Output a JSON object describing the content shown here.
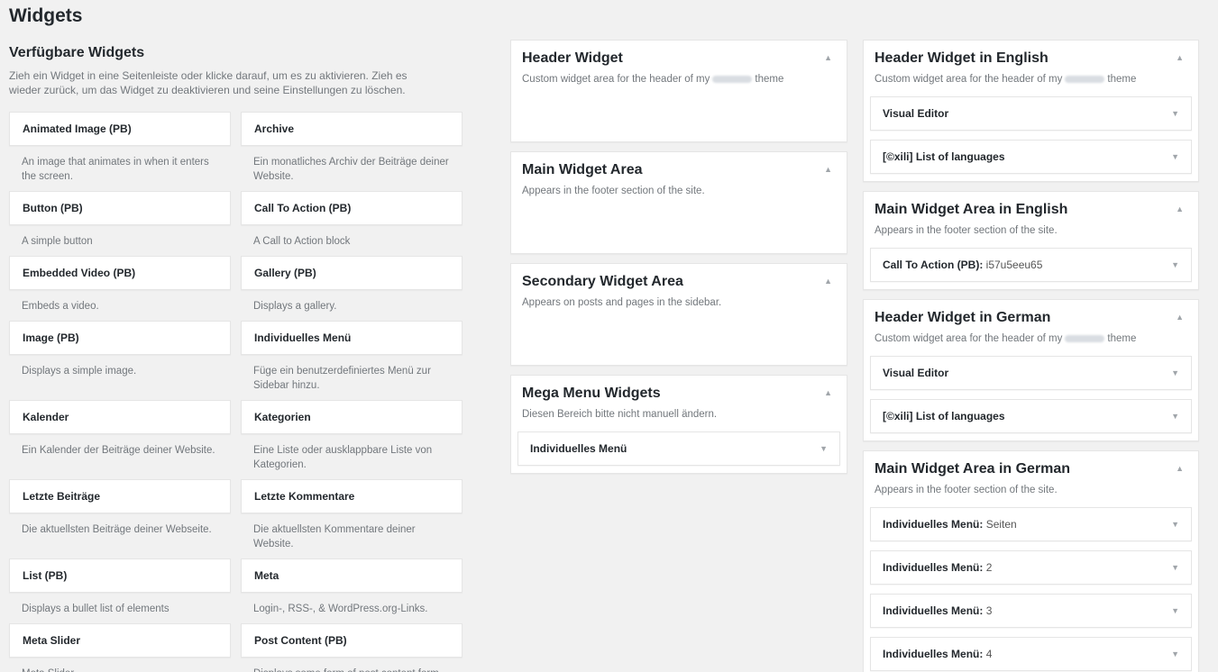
{
  "page": {
    "title": "Widgets"
  },
  "available": {
    "title": "Verfügbare Widgets",
    "description": "Zieh ein Widget in eine Seitenleiste oder klicke darauf, um es zu aktivieren. Zieh es wieder zurück, um das Widget zu deaktivieren und seine Einstellungen zu löschen.",
    "widgets": [
      {
        "name": "Animated Image (PB)",
        "desc": "An image that animates in when it enters the screen."
      },
      {
        "name": "Archive",
        "desc": "Ein monatliches Archiv der Beiträge deiner Website."
      },
      {
        "name": "Button (PB)",
        "desc": "A simple button"
      },
      {
        "name": "Call To Action (PB)",
        "desc": "A Call to Action block"
      },
      {
        "name": "Embedded Video (PB)",
        "desc": "Embeds a video."
      },
      {
        "name": "Gallery (PB)",
        "desc": "Displays a gallery."
      },
      {
        "name": "Image (PB)",
        "desc": "Displays a simple image."
      },
      {
        "name": "Individuelles Menü",
        "desc": "Füge ein benutzerdefiniertes Menü zur Sidebar hinzu."
      },
      {
        "name": "Kalender",
        "desc": "Ein Kalender der Beiträge deiner Website."
      },
      {
        "name": "Kategorien",
        "desc": "Eine Liste oder ausklappbare Liste von Kategorien."
      },
      {
        "name": "Letzte Beiträge",
        "desc": "Die aktuellsten Beiträge deiner Webseite."
      },
      {
        "name": "Letzte Kommentare",
        "desc": "Die aktuellsten Kommentare deiner Website."
      },
      {
        "name": "List (PB)",
        "desc": "Displays a bullet list of elements"
      },
      {
        "name": "Meta",
        "desc": "Login-, RSS-, & WordPress.org-Links."
      },
      {
        "name": "Meta Slider",
        "desc": "Meta Slider"
      },
      {
        "name": "Post Content (PB)",
        "desc": "Displays some form of post content form"
      }
    ]
  },
  "sidebars_mid": [
    {
      "title": "Header Widget",
      "desc_pre": "Custom widget area for the header of my",
      "blurred": true,
      "desc_post": "theme",
      "widgets": []
    },
    {
      "title": "Main Widget Area",
      "desc_pre": "Appears in the footer section of the site.",
      "blurred": false,
      "desc_post": "",
      "widgets": []
    },
    {
      "title": "Secondary Widget Area",
      "desc_pre": "Appears on posts and pages in the sidebar.",
      "blurred": false,
      "desc_post": "",
      "widgets": []
    },
    {
      "title": "Mega Menu Widgets",
      "desc_pre": "Diesen Bereich bitte nicht manuell ändern.",
      "blurred": false,
      "desc_post": "",
      "widgets": [
        {
          "name": "Individuelles Menü",
          "instance": ""
        }
      ]
    }
  ],
  "sidebars_right": [
    {
      "title": "Header Widget in English",
      "desc_pre": "Custom widget area for the header of my",
      "blurred": true,
      "desc_post": "theme",
      "widgets": [
        {
          "name": "Visual Editor",
          "instance": ""
        },
        {
          "name": "[©xili] List of languages",
          "instance": ""
        }
      ]
    },
    {
      "title": "Main Widget Area in English",
      "desc_pre": "Appears in the footer section of the site.",
      "blurred": false,
      "desc_post": "",
      "widgets": [
        {
          "name": "Call To Action (PB):",
          "instance": "i57u5eeu65"
        }
      ]
    },
    {
      "title": "Header Widget in German",
      "desc_pre": "Custom widget area for the header of my",
      "blurred": true,
      "desc_post": "theme",
      "widgets": [
        {
          "name": "Visual Editor",
          "instance": ""
        },
        {
          "name": "[©xili] List of languages",
          "instance": ""
        }
      ]
    },
    {
      "title": "Main Widget Area in German",
      "desc_pre": "Appears in the footer section of the site.",
      "blurred": false,
      "desc_post": "",
      "widgets": [
        {
          "name": "Individuelles Menü:",
          "instance": "Seiten"
        },
        {
          "name": "Individuelles Menü:",
          "instance": "2"
        },
        {
          "name": "Individuelles Menü:",
          "instance": "3"
        },
        {
          "name": "Individuelles Menü:",
          "instance": "4"
        }
      ]
    }
  ],
  "icons": {
    "collapse": "▲",
    "expand": "▼"
  }
}
